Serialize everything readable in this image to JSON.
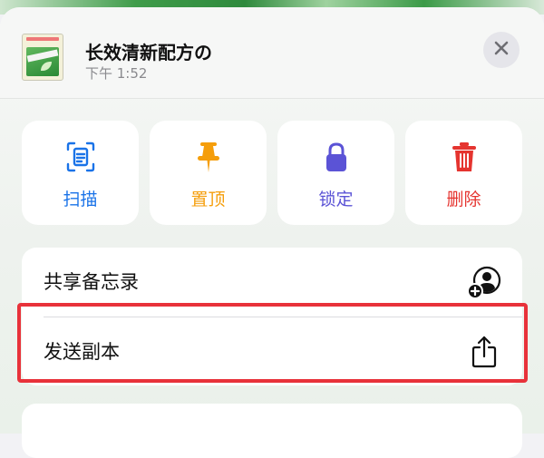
{
  "note": {
    "title": "长效清新配方の",
    "time": "下午 1:52"
  },
  "actions": [
    {
      "label": "扫描",
      "icon": "scan-icon",
      "color": "#1a73e8"
    },
    {
      "label": "置顶",
      "icon": "pin-icon",
      "color": "#f59e0b"
    },
    {
      "label": "锁定",
      "icon": "lock-icon",
      "color": "#5b53d6"
    },
    {
      "label": "删除",
      "icon": "trash-icon",
      "color": "#e5342f"
    }
  ],
  "menu": {
    "items": [
      {
        "label": "共享备忘录",
        "icon": "share-person-icon"
      },
      {
        "label": "发送副本",
        "icon": "share-up-icon"
      }
    ]
  },
  "colors": {
    "highlight": "#e8323a"
  }
}
